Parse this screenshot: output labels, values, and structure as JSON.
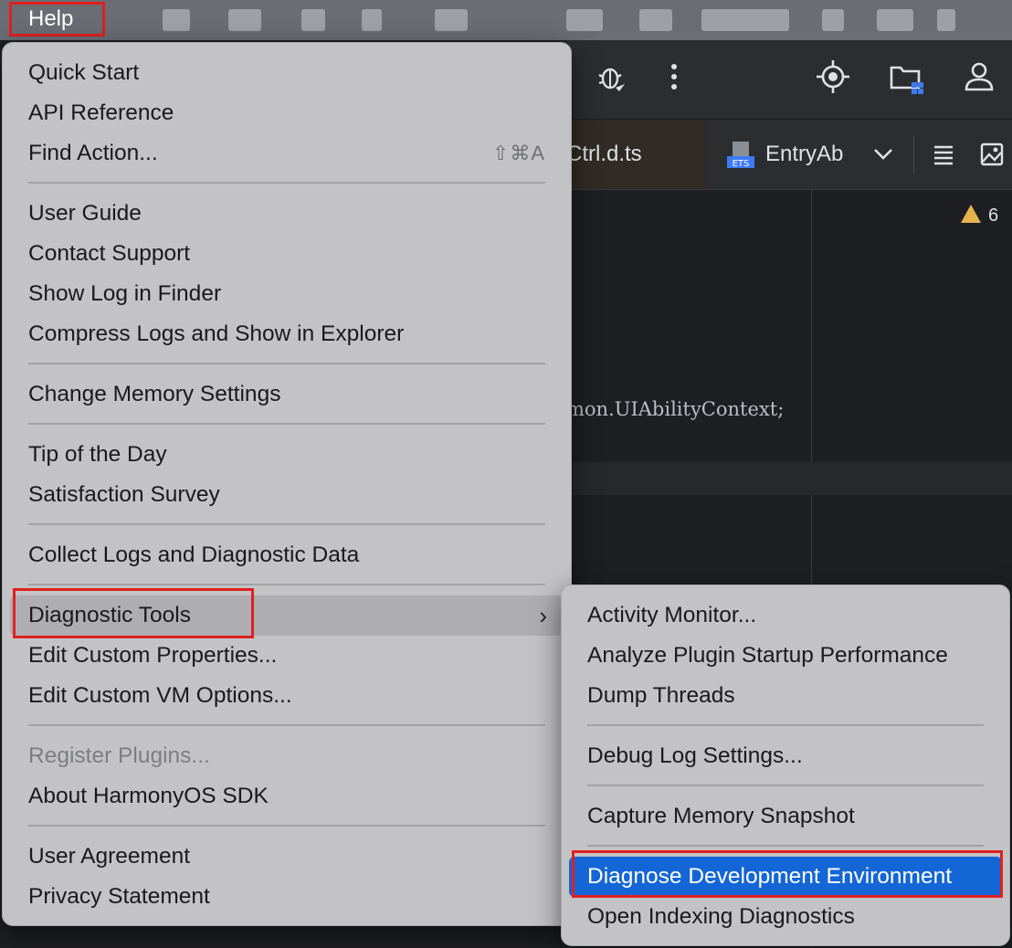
{
  "menubar": {
    "help_label": "Help"
  },
  "toolbar": {
    "icons": [
      "debug-bug-icon",
      "more-vertical-icon",
      "target-locate-icon",
      "project-folder-icon",
      "account-icon"
    ]
  },
  "tabs": {
    "active_tab_label": "Ctrl.d.ts",
    "second_tab_label": "EntryAb",
    "second_tab_icon_text": "ETS"
  },
  "editor": {
    "warning_count": "6",
    "code_line": "mon.UIAbilityContext;"
  },
  "help_menu": {
    "items": [
      {
        "label": "Quick Start"
      },
      {
        "label": "API Reference"
      },
      {
        "label": "Find Action...",
        "shortcut": "⇧⌘A"
      },
      {
        "label": "User Guide"
      },
      {
        "label": "Contact Support"
      },
      {
        "label": "Show Log in Finder"
      },
      {
        "label": "Compress Logs and Show in Explorer"
      },
      {
        "label": "Change Memory Settings"
      },
      {
        "label": "Tip of the Day"
      },
      {
        "label": "Satisfaction Survey"
      },
      {
        "label": "Collect Logs and Diagnostic Data"
      },
      {
        "label": "Diagnostic Tools"
      },
      {
        "label": "Edit Custom Properties..."
      },
      {
        "label": "Edit Custom VM Options..."
      },
      {
        "label": "Register Plugins..."
      },
      {
        "label": "About HarmonyOS SDK"
      },
      {
        "label": "User Agreement"
      },
      {
        "label": "Privacy Statement"
      }
    ]
  },
  "diagnostic_submenu": {
    "items": [
      {
        "label": "Activity Monitor..."
      },
      {
        "label": "Analyze Plugin Startup Performance"
      },
      {
        "label": "Dump Threads"
      },
      {
        "label": "Debug Log Settings..."
      },
      {
        "label": "Capture Memory Snapshot"
      },
      {
        "label": "Diagnose Development Environment"
      },
      {
        "label": "Open Indexing Diagnostics"
      }
    ]
  },
  "colors": {
    "highlight_box": "#e02020",
    "selection": "#1466d6",
    "menu_bg": "#c3c3c6"
  }
}
